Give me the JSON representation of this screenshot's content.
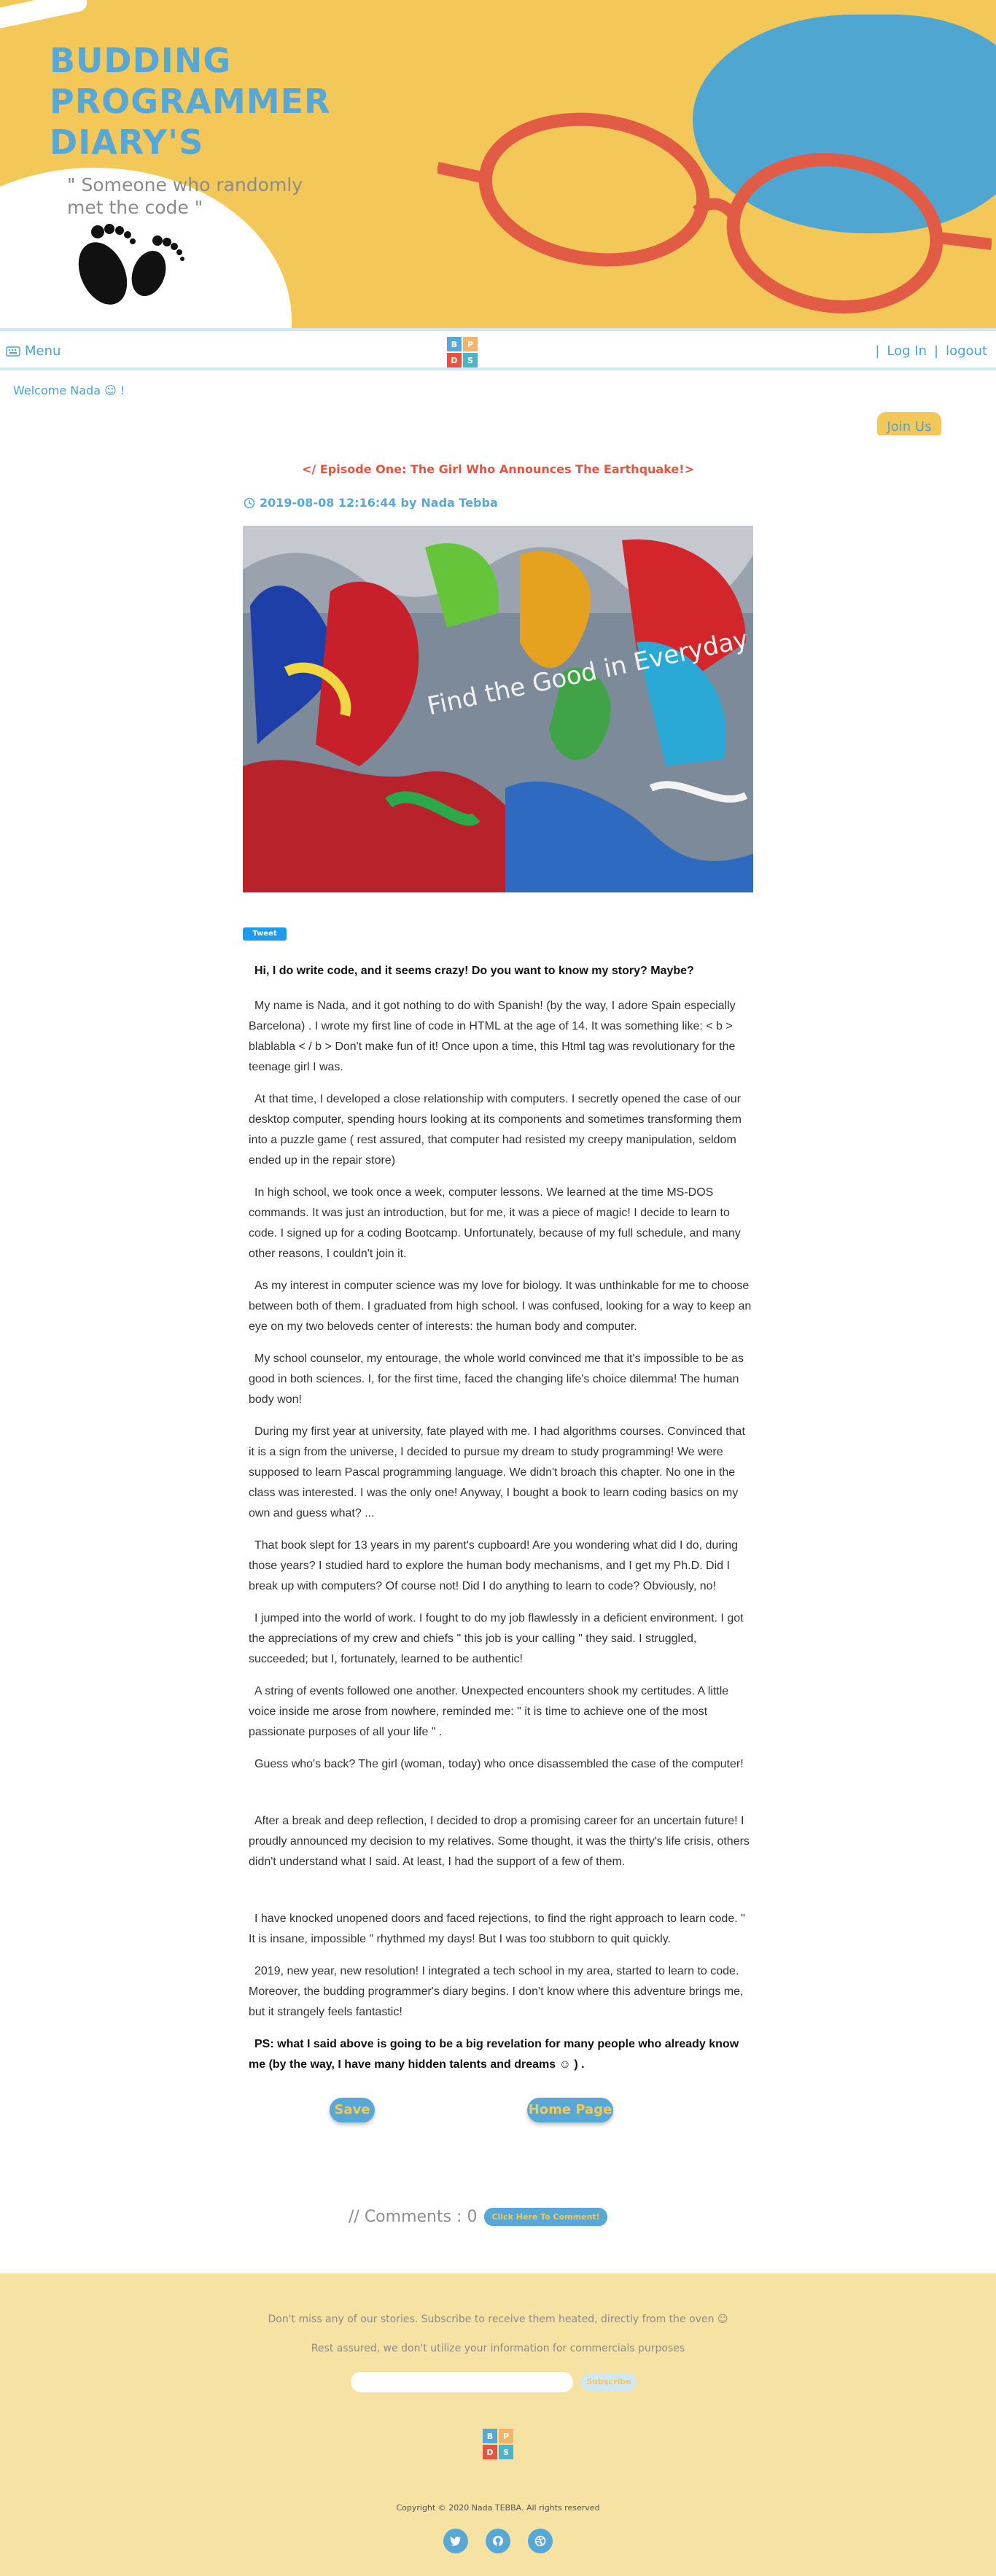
{
  "colors": {
    "accent": "#57a8d6",
    "yellow": "#f3c858",
    "red": "#e6543f",
    "footer_bg": "#f6e2a2"
  },
  "hero": {
    "title_lines": [
      "BUDDING",
      "PROGRAMMER",
      "DIARY'S"
    ],
    "subtitle_lines": [
      "\" Someone who randomly",
      "met the code \""
    ]
  },
  "nav": {
    "menu_icon": "keyboard-icon",
    "menu_label": "Menu",
    "logo_letters": [
      "B",
      "P",
      "D",
      "S"
    ],
    "login_label": "Log In",
    "logout_label": "logout",
    "separator": "|"
  },
  "welcome": "Welcome Nada ☺ !",
  "join_label": "Join Us",
  "post": {
    "title": "</ Episode One: The Girl Who Announces The Earthquake!>",
    "datetime": "2019-08-08 12:16:44",
    "by_label": "by",
    "author": "Nada Tebba",
    "image_text": "Find the Good in Everyday",
    "tweet_label": "Tweet",
    "lead": "Hi, I do write code, and it seems crazy! Do you want to know my story? Maybe?",
    "paragraphs": [
      "My name is Nada, and it got nothing to do with Spanish! (by the way, I adore Spain especially Barcelona) . I wrote my first line of code in HTML at the age of 14. It was something like: < b > blablabla < / b > Don't make fun of it! Once upon a time, this Html tag was revolutionary for the teenage girl I was.",
      "At that time, I developed a close relationship with computers. I secretly opened the case of our desktop computer, spending hours looking at its components and sometimes transforming them into a puzzle game ( rest assured, that computer had resisted my creepy manipulation, seldom ended up in the repair store)",
      "In high school, we took once a week, computer lessons. We learned at the time MS-DOS commands. It was just an introduction, but for me, it was a piece of magic! I decide to learn to code. I signed up for a coding Bootcamp. Unfortunately, because of my full schedule, and many other reasons, I couldn't join it.",
      "As my interest in computer science was my love for biology. It was unthinkable for me to choose between both of them. I graduated from high school. I was confused, looking for a way to keep an eye on my two beloveds center of interests: the human body and computer.",
      "My school counselor, my entourage, the whole world convinced me that it's impossible to be as good in both sciences. I, for the first time, faced the changing life's choice dilemma! The human body won!",
      "During my first year at university, fate played with me. I had algorithms courses. Convinced that it is a sign from the universe, I decided to pursue my dream to study programming! We were supposed to learn Pascal programming language. We didn't broach this chapter. No one in the class was interested. I was the only one! Anyway, I bought a book to learn coding basics on my own and guess what? ...",
      "That book slept for 13 years in my parent's cupboard! Are you wondering what did I do, during those years? I studied hard to explore the human body mechanisms, and I get my Ph.D. Did I break up with computers? Of course not! Did I do anything to learn to code? Obviously, no!",
      "I jumped into the world of work. I fought to do my job flawlessly in a deficient environment. I got the appreciations of my crew and chiefs \" this job is your calling \" they said. I struggled, succeeded; but I, fortunately, learned to be authentic!",
      "A string of events followed one another. Unexpected encounters shook my certitudes. A little voice inside me arose from nowhere, reminded me: \" it is time to achieve one of the most passionate purposes of all your life \" .",
      "Guess who's back? The girl (woman, today) who once disassembled the case of the computer!"
    ],
    "paragraphs_b": [
      "After a break and deep reflection, I decided to drop a promising career for an uncertain future! I proudly announced my decision to my relatives. Some thought, it was the thirty's life crisis, others didn't understand what I said. At least, I had the support of a few of them."
    ],
    "paragraphs_c": [
      "I have knocked unopened doors and faced rejections, to find the right approach to learn code. \" It is insane, impossible \" rhythmed my days! But I was too stubborn to quit quickly.",
      "2019, new year, new resolution! I integrated a tech school in my area, started to learn to code. Moreover, the budding programmer's diary begins. I don't know where this adventure brings me, but it strangely feels fantastic!"
    ],
    "ps": "PS: what I said above is going to be a big revelation for many people who already know me (by the way, I have many hidden talents and dreams ☺ ) ."
  },
  "actions": {
    "save_label": "Save",
    "home_label": "Home Page"
  },
  "comments": {
    "label": "// Comments : 0",
    "cta": "Click Here To Comment!"
  },
  "footer": {
    "line1": "Don't miss any of our stories. Subscribe to receive them heated, directly from the oven ☺",
    "line2": "Rest assured, we don't utilize your information for commercials purposes",
    "subscribe_label": "Subscribe",
    "copyright": "Copyright © 2020 Nada TEBBA. All rights reserved",
    "social_icons": [
      "twitter-icon",
      "github-icon",
      "dribbble-icon"
    ]
  }
}
